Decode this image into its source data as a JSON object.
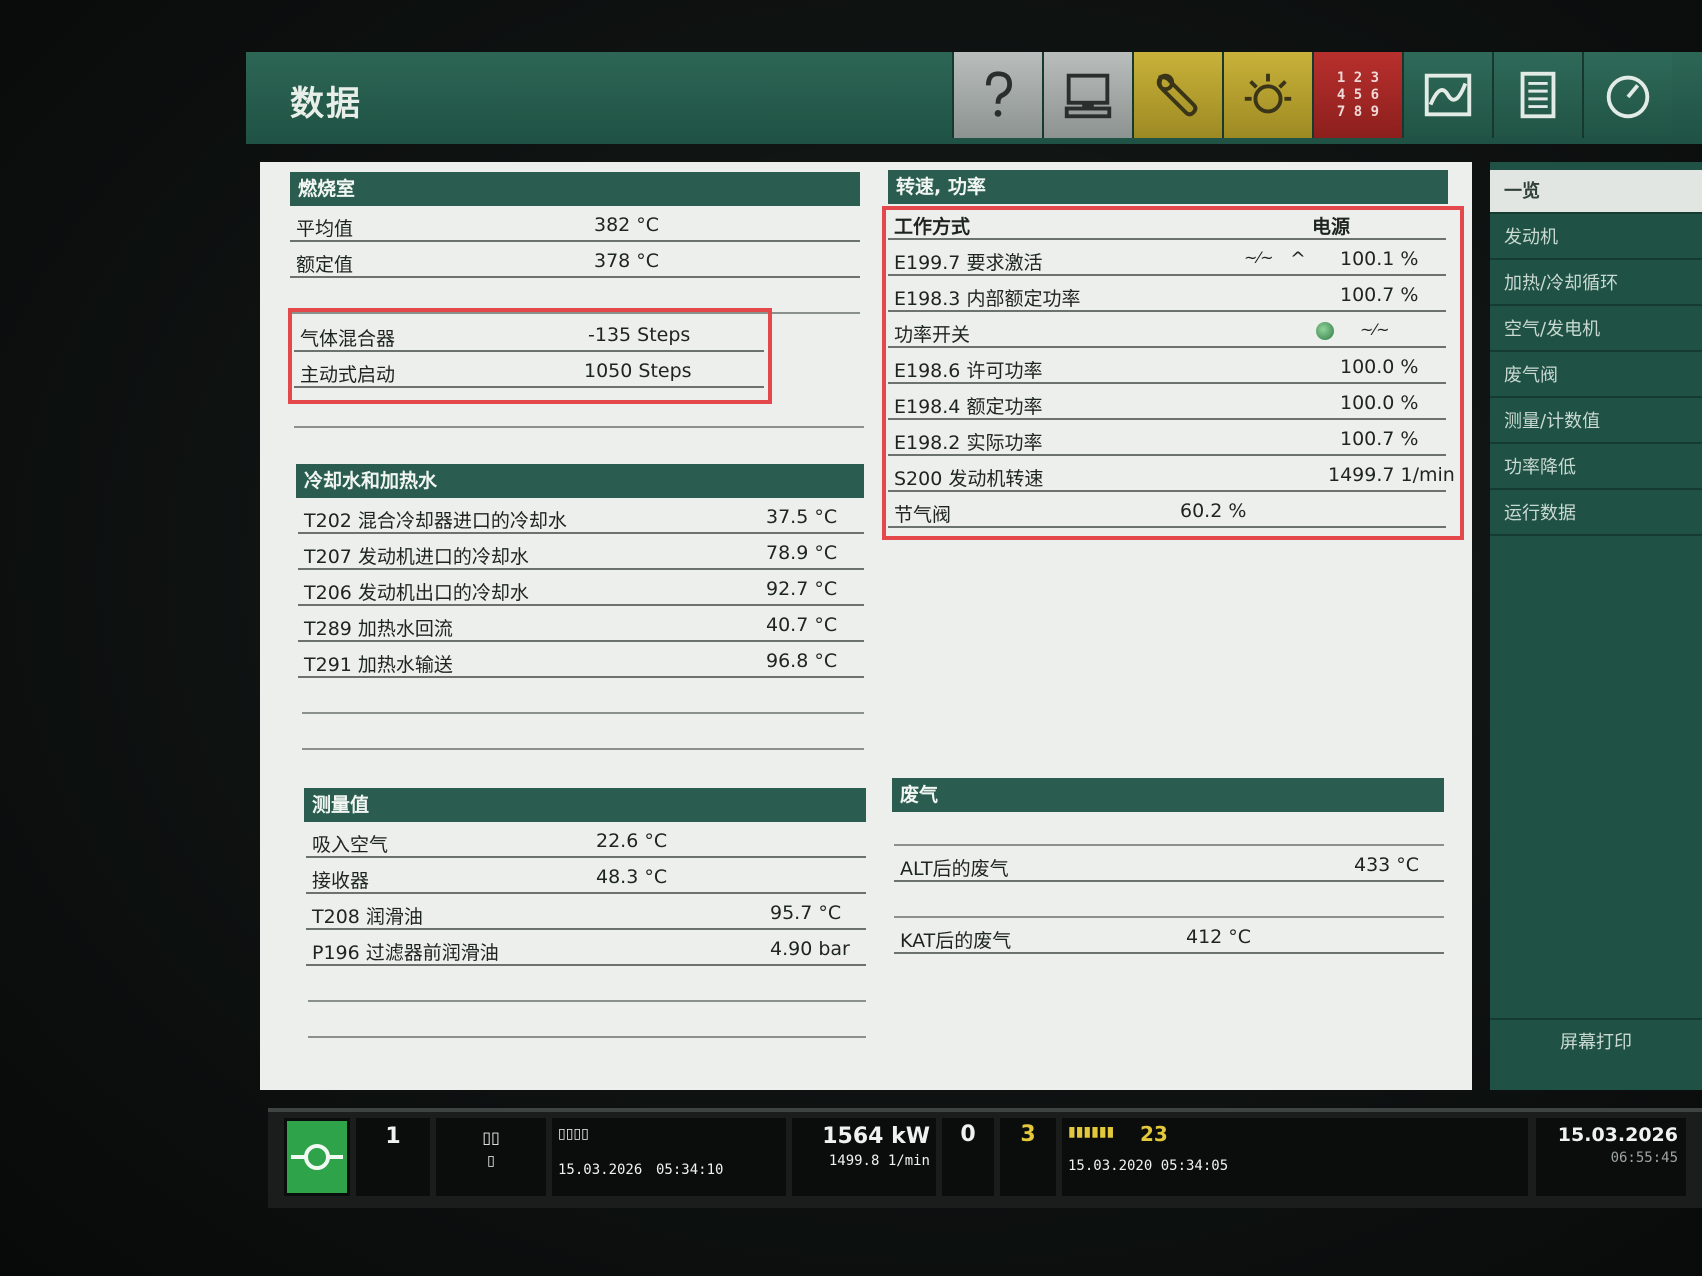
{
  "app": {
    "title": "数据"
  },
  "toolbar": {
    "help_icon": "question-icon",
    "monitor_icon": "monitor-icon",
    "tools_icon": "wrench-icon",
    "light_icon": "lamp-icon",
    "keypad_lines": [
      "1 2 3",
      "4 5 6",
      "7 8 9"
    ],
    "trend_icon": "trend-chart-icon",
    "list_icon": "document-list-icon",
    "gauge_icon": "gauge-icon"
  },
  "combustion": {
    "header": "燃烧室",
    "rows": [
      {
        "label": "平均值",
        "value": "382 °C"
      },
      {
        "label": "额定值",
        "value": "378 °C"
      }
    ],
    "extra_rows": [
      {
        "label": "气体混合器",
        "value": "-135 Steps"
      },
      {
        "label": "主动式启动",
        "value": "1050 Steps"
      }
    ]
  },
  "cooling": {
    "header": "冷却水和加热水",
    "rows": [
      {
        "label": "T202 混合冷却器进口的冷却水",
        "value": "37.5 °C"
      },
      {
        "label": "T207 发动机进口的冷却水",
        "value": "78.9 °C"
      },
      {
        "label": "T206 发动机出口的冷却水",
        "value": "92.7 °C"
      },
      {
        "label": "T289 加热水回流",
        "value": "40.7 °C"
      },
      {
        "label": "T291 加热水输送",
        "value": "96.8 °C"
      }
    ]
  },
  "measured": {
    "header": "测量值",
    "rows": [
      {
        "label": "吸入空气",
        "value": "22.6 °C"
      },
      {
        "label": "接收器",
        "value": "48.3 °C"
      },
      {
        "label": "T208 润滑油",
        "value": "95.7 °C"
      },
      {
        "label": "P196 过滤器前润滑油",
        "value": "4.90 bar"
      }
    ]
  },
  "speed_power": {
    "header": "转速, 功率",
    "mode_label": "工作方式",
    "mode_value": "电源",
    "rows": [
      {
        "label": "E199.7 要求激活",
        "value": "100.1 %"
      },
      {
        "label": "E198.3 内部额定功率",
        "value": "100.7 %"
      },
      {
        "label": "功率开关",
        "value": ""
      },
      {
        "label": "E198.6 许可功率",
        "value": "100.0 %"
      },
      {
        "label": "E198.4 额定功率",
        "value": "100.0 %"
      },
      {
        "label": "E198.2 实际功率",
        "value": "100.7 %"
      },
      {
        "label": "S200 发动机转速",
        "value": "1499.7 1/min"
      },
      {
        "label": "节气阀",
        "value": "60.2 %"
      }
    ]
  },
  "exhaust": {
    "header": "废气",
    "rows": [
      {
        "label": "ALT后的废气",
        "value": "433 °C"
      },
      {
        "label": "KAT后的废气",
        "value": "412 °C"
      }
    ]
  },
  "sidebar": {
    "items": [
      {
        "label": "一览"
      },
      {
        "label": "发动机"
      },
      {
        "label": "加热/冷却循环"
      },
      {
        "label": "空气/发电机"
      },
      {
        "label": "废气阀"
      },
      {
        "label": "测量/计数值"
      },
      {
        "label": "功率降低"
      },
      {
        "label": "运行数据"
      }
    ],
    "print_label": "屏幕打印"
  },
  "statusbar": {
    "unit_number": "1",
    "event_date": "15.03.2026",
    "event_time": "05:34:10",
    "power": "1564 kW",
    "speed": "1499.8 1/min",
    "count_a": "0",
    "count_b": "3",
    "alarm_count": "23",
    "alarm_timestamp": "15.03.2020 05:34:05",
    "date": "15.03.2026",
    "time": "06:55:45"
  },
  "colors": {
    "header_green": "#2a5d4f",
    "highlight_red": "#e5484a",
    "status_yellow": "#e2c83a",
    "run_green": "#2fa34a"
  }
}
